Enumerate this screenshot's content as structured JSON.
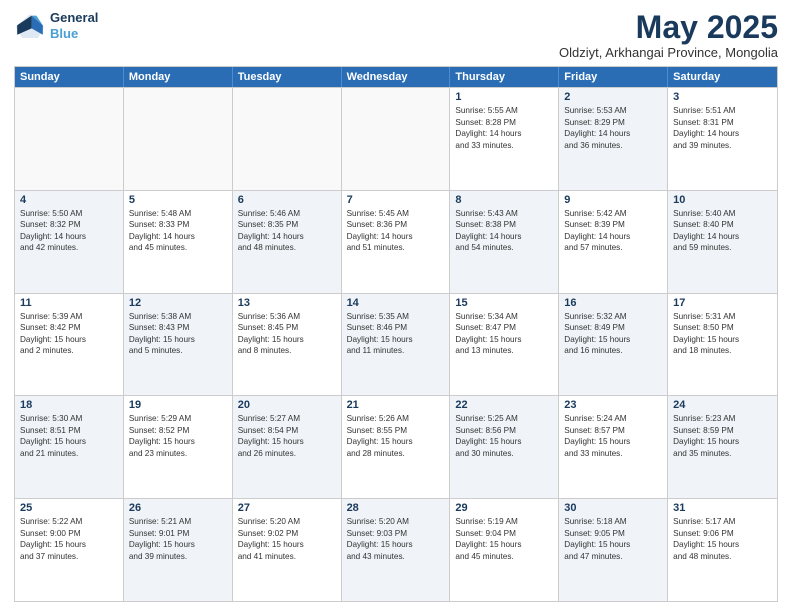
{
  "logo": {
    "line1": "General",
    "line2": "Blue"
  },
  "title": "May 2025",
  "subtitle": "Oldziyt, Arkhangai Province, Mongolia",
  "col_headers": [
    "Sunday",
    "Monday",
    "Tuesday",
    "Wednesday",
    "Thursday",
    "Friday",
    "Saturday"
  ],
  "rows": [
    [
      {
        "day": "",
        "lines": [],
        "empty": true
      },
      {
        "day": "",
        "lines": [],
        "empty": true
      },
      {
        "day": "",
        "lines": [],
        "empty": true
      },
      {
        "day": "",
        "lines": [],
        "empty": true
      },
      {
        "day": "1",
        "lines": [
          "Sunrise: 5:55 AM",
          "Sunset: 8:28 PM",
          "Daylight: 14 hours",
          "and 33 minutes."
        ],
        "shaded": false
      },
      {
        "day": "2",
        "lines": [
          "Sunrise: 5:53 AM",
          "Sunset: 8:29 PM",
          "Daylight: 14 hours",
          "and 36 minutes."
        ],
        "shaded": true
      },
      {
        "day": "3",
        "lines": [
          "Sunrise: 5:51 AM",
          "Sunset: 8:31 PM",
          "Daylight: 14 hours",
          "and 39 minutes."
        ],
        "shaded": false
      }
    ],
    [
      {
        "day": "4",
        "lines": [
          "Sunrise: 5:50 AM",
          "Sunset: 8:32 PM",
          "Daylight: 14 hours",
          "and 42 minutes."
        ],
        "shaded": true
      },
      {
        "day": "5",
        "lines": [
          "Sunrise: 5:48 AM",
          "Sunset: 8:33 PM",
          "Daylight: 14 hours",
          "and 45 minutes."
        ],
        "shaded": false
      },
      {
        "day": "6",
        "lines": [
          "Sunrise: 5:46 AM",
          "Sunset: 8:35 PM",
          "Daylight: 14 hours",
          "and 48 minutes."
        ],
        "shaded": true
      },
      {
        "day": "7",
        "lines": [
          "Sunrise: 5:45 AM",
          "Sunset: 8:36 PM",
          "Daylight: 14 hours",
          "and 51 minutes."
        ],
        "shaded": false
      },
      {
        "day": "8",
        "lines": [
          "Sunrise: 5:43 AM",
          "Sunset: 8:38 PM",
          "Daylight: 14 hours",
          "and 54 minutes."
        ],
        "shaded": true
      },
      {
        "day": "9",
        "lines": [
          "Sunrise: 5:42 AM",
          "Sunset: 8:39 PM",
          "Daylight: 14 hours",
          "and 57 minutes."
        ],
        "shaded": false
      },
      {
        "day": "10",
        "lines": [
          "Sunrise: 5:40 AM",
          "Sunset: 8:40 PM",
          "Daylight: 14 hours",
          "and 59 minutes."
        ],
        "shaded": true
      }
    ],
    [
      {
        "day": "11",
        "lines": [
          "Sunrise: 5:39 AM",
          "Sunset: 8:42 PM",
          "Daylight: 15 hours",
          "and 2 minutes."
        ],
        "shaded": false
      },
      {
        "day": "12",
        "lines": [
          "Sunrise: 5:38 AM",
          "Sunset: 8:43 PM",
          "Daylight: 15 hours",
          "and 5 minutes."
        ],
        "shaded": true
      },
      {
        "day": "13",
        "lines": [
          "Sunrise: 5:36 AM",
          "Sunset: 8:45 PM",
          "Daylight: 15 hours",
          "and 8 minutes."
        ],
        "shaded": false
      },
      {
        "day": "14",
        "lines": [
          "Sunrise: 5:35 AM",
          "Sunset: 8:46 PM",
          "Daylight: 15 hours",
          "and 11 minutes."
        ],
        "shaded": true
      },
      {
        "day": "15",
        "lines": [
          "Sunrise: 5:34 AM",
          "Sunset: 8:47 PM",
          "Daylight: 15 hours",
          "and 13 minutes."
        ],
        "shaded": false
      },
      {
        "day": "16",
        "lines": [
          "Sunrise: 5:32 AM",
          "Sunset: 8:49 PM",
          "Daylight: 15 hours",
          "and 16 minutes."
        ],
        "shaded": true
      },
      {
        "day": "17",
        "lines": [
          "Sunrise: 5:31 AM",
          "Sunset: 8:50 PM",
          "Daylight: 15 hours",
          "and 18 minutes."
        ],
        "shaded": false
      }
    ],
    [
      {
        "day": "18",
        "lines": [
          "Sunrise: 5:30 AM",
          "Sunset: 8:51 PM",
          "Daylight: 15 hours",
          "and 21 minutes."
        ],
        "shaded": true
      },
      {
        "day": "19",
        "lines": [
          "Sunrise: 5:29 AM",
          "Sunset: 8:52 PM",
          "Daylight: 15 hours",
          "and 23 minutes."
        ],
        "shaded": false
      },
      {
        "day": "20",
        "lines": [
          "Sunrise: 5:27 AM",
          "Sunset: 8:54 PM",
          "Daylight: 15 hours",
          "and 26 minutes."
        ],
        "shaded": true
      },
      {
        "day": "21",
        "lines": [
          "Sunrise: 5:26 AM",
          "Sunset: 8:55 PM",
          "Daylight: 15 hours",
          "and 28 minutes."
        ],
        "shaded": false
      },
      {
        "day": "22",
        "lines": [
          "Sunrise: 5:25 AM",
          "Sunset: 8:56 PM",
          "Daylight: 15 hours",
          "and 30 minutes."
        ],
        "shaded": true
      },
      {
        "day": "23",
        "lines": [
          "Sunrise: 5:24 AM",
          "Sunset: 8:57 PM",
          "Daylight: 15 hours",
          "and 33 minutes."
        ],
        "shaded": false
      },
      {
        "day": "24",
        "lines": [
          "Sunrise: 5:23 AM",
          "Sunset: 8:59 PM",
          "Daylight: 15 hours",
          "and 35 minutes."
        ],
        "shaded": true
      }
    ],
    [
      {
        "day": "25",
        "lines": [
          "Sunrise: 5:22 AM",
          "Sunset: 9:00 PM",
          "Daylight: 15 hours",
          "and 37 minutes."
        ],
        "shaded": false
      },
      {
        "day": "26",
        "lines": [
          "Sunrise: 5:21 AM",
          "Sunset: 9:01 PM",
          "Daylight: 15 hours",
          "and 39 minutes."
        ],
        "shaded": true
      },
      {
        "day": "27",
        "lines": [
          "Sunrise: 5:20 AM",
          "Sunset: 9:02 PM",
          "Daylight: 15 hours",
          "and 41 minutes."
        ],
        "shaded": false
      },
      {
        "day": "28",
        "lines": [
          "Sunrise: 5:20 AM",
          "Sunset: 9:03 PM",
          "Daylight: 15 hours",
          "and 43 minutes."
        ],
        "shaded": true
      },
      {
        "day": "29",
        "lines": [
          "Sunrise: 5:19 AM",
          "Sunset: 9:04 PM",
          "Daylight: 15 hours",
          "and 45 minutes."
        ],
        "shaded": false
      },
      {
        "day": "30",
        "lines": [
          "Sunrise: 5:18 AM",
          "Sunset: 9:05 PM",
          "Daylight: 15 hours",
          "and 47 minutes."
        ],
        "shaded": true
      },
      {
        "day": "31",
        "lines": [
          "Sunrise: 5:17 AM",
          "Sunset: 9:06 PM",
          "Daylight: 15 hours",
          "and 48 minutes."
        ],
        "shaded": false
      }
    ]
  ]
}
